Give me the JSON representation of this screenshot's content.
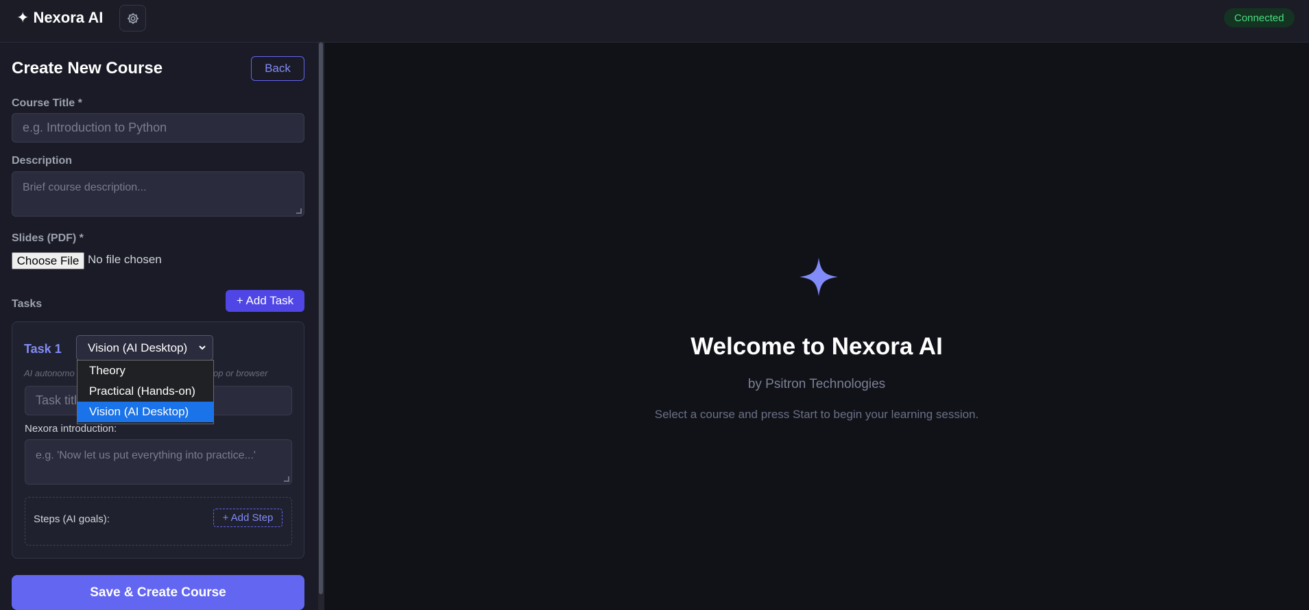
{
  "app": {
    "brand_icon": "sparkle-icon",
    "brand_name": "Nexora AI",
    "settings_icon": "gear-icon",
    "status": "Connected",
    "colors": {
      "accent": "#6366f1",
      "status": "#4ade80"
    }
  },
  "form": {
    "heading": "Create New Course",
    "back_label": "Back",
    "course_title_label": "Course Title *",
    "course_title_placeholder": "e.g. Introduction to Python",
    "description_label": "Description",
    "description_placeholder": "Brief course description...",
    "slides_label": "Slides (PDF) *",
    "choose_file_label": "Choose File",
    "no_file_text": "No file chosen",
    "tasks_label": "Tasks",
    "add_task_label": "+ Add Task",
    "task": {
      "title": "Task 1",
      "type_selected": "Vision (AI Desktop)",
      "type_options": [
        "Theory",
        "Practical (Hands-on)",
        "Vision (AI Desktop)"
      ],
      "hint_left": "AI autonomo",
      "hint_right": "op or browser",
      "task_title_placeholder": "Task title",
      "intro_label": "Nexora introduction:",
      "intro_placeholder": "e.g. 'Now let us put everything into practice...'",
      "steps_label": "Steps (AI goals):",
      "add_step_label": "+ Add Step"
    },
    "save_label": "Save & Create Course"
  },
  "welcome": {
    "icon": "sparkle-icon",
    "title": "Welcome to Nexora AI",
    "subtitle": "by Psitron Technologies",
    "hint": "Select a course and press Start to begin your learning session."
  }
}
